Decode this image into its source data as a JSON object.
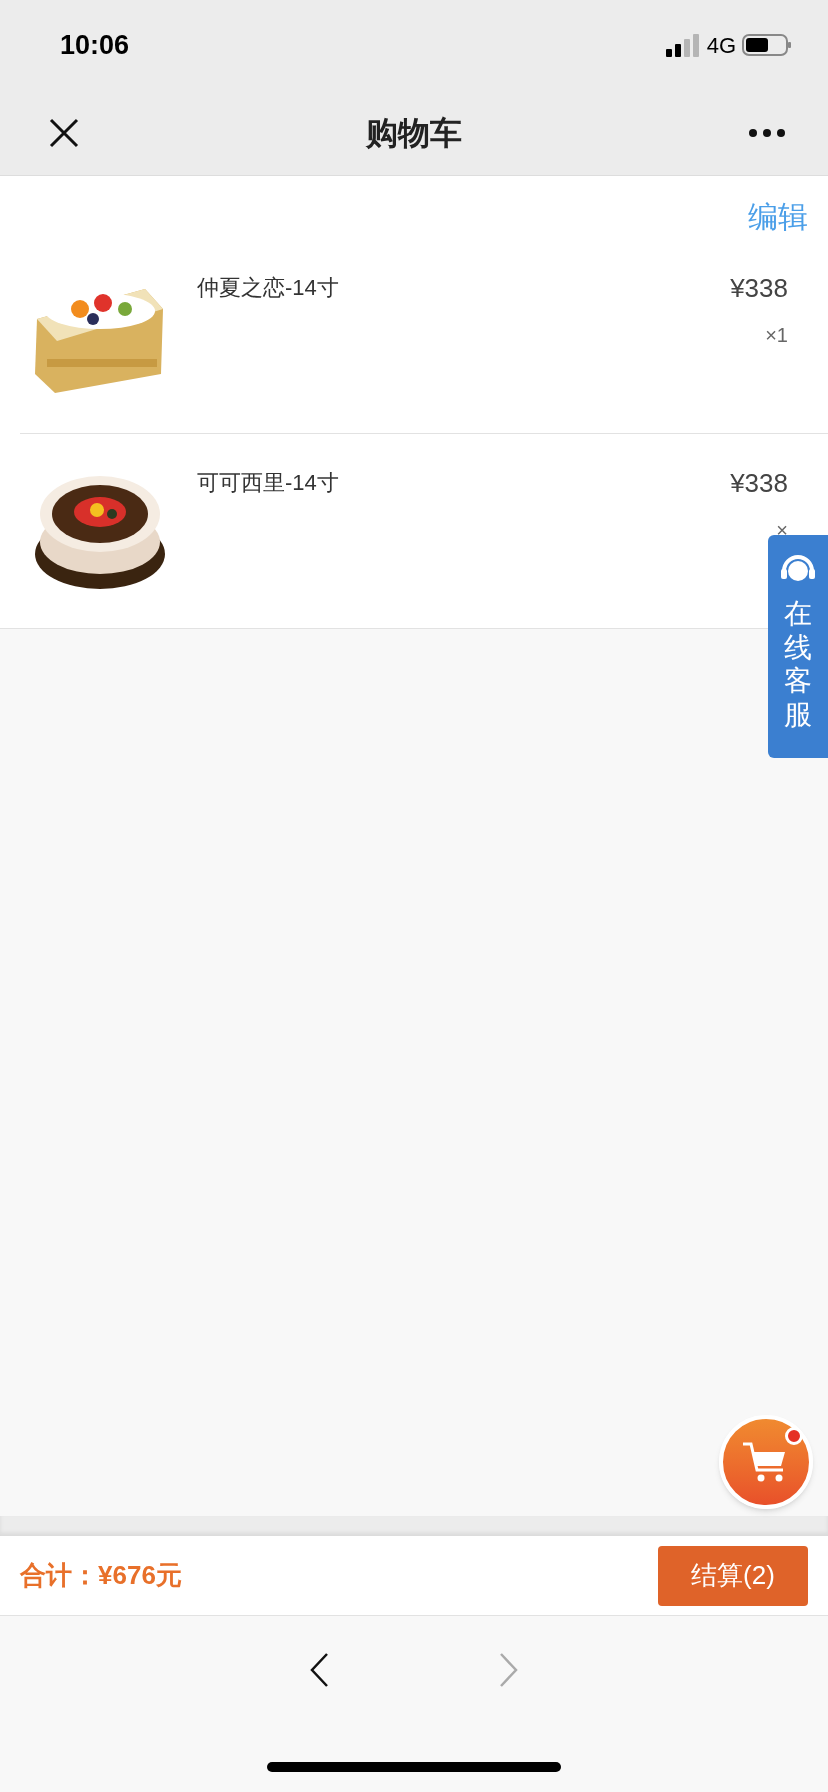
{
  "status_bar": {
    "time": "10:06",
    "network": "4G"
  },
  "nav": {
    "title": "购物车"
  },
  "edit_label": "编辑",
  "items": [
    {
      "name": "仲夏之恋-14寸",
      "price": "¥338",
      "quantity": "×1",
      "kind": "picture"
    },
    {
      "name": "可可西里-14寸",
      "price": "¥338",
      "quantity": "×",
      "kind": "picture"
    }
  ],
  "service_tab": {
    "label": "在线客服"
  },
  "footer": {
    "total": "合计：¥676元",
    "checkout": "结算(2)"
  },
  "browser_nav": [
    {
      "kind": "back",
      "disabled": false
    },
    {
      "kind": "forward",
      "disabled": true
    }
  ]
}
